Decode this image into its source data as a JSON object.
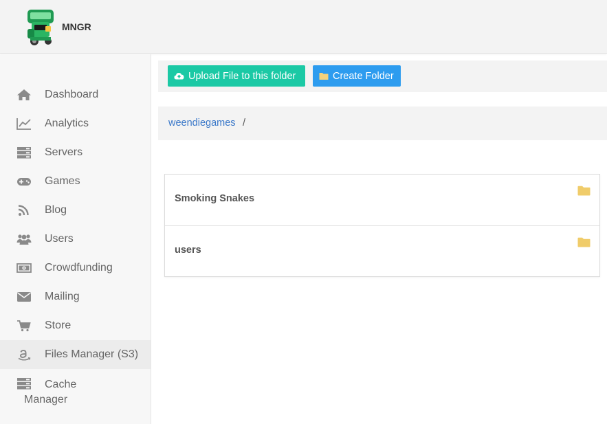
{
  "header": {
    "app_name": "MNGR",
    "logo_icon": "green-robot-logo"
  },
  "sidebar": {
    "items": [
      {
        "label": "Dashboard",
        "icon": "home-icon"
      },
      {
        "label": "Analytics",
        "icon": "line-chart-icon"
      },
      {
        "label": "Servers",
        "icon": "server-icon"
      },
      {
        "label": "Games",
        "icon": "gamepad-icon"
      },
      {
        "label": "Blog",
        "icon": "rss-icon"
      },
      {
        "label": "Users",
        "icon": "users-icon"
      },
      {
        "label": "Crowdfunding",
        "icon": "money-icon"
      },
      {
        "label": "Mailing",
        "icon": "envelope-icon"
      },
      {
        "label": "Store",
        "icon": "shopping-cart-icon"
      },
      {
        "label": "Files Manager (S3)",
        "icon": "amazon-icon",
        "active": true
      },
      {
        "label": "Cache Manager",
        "icon": "server-icon"
      }
    ]
  },
  "toolbar": {
    "upload_label": "Upload File to this folder",
    "create_folder_label": "Create Folder"
  },
  "breadcrumb": {
    "root": "weendiegames",
    "separator": "/"
  },
  "folders": [
    {
      "name": "Smoking Snakes"
    },
    {
      "name": "users"
    }
  ],
  "colors": {
    "upload_button": "#1bc9a5",
    "create_folder_button": "#2d9cef",
    "folder_icon": "#f0cc6a",
    "link": "#3a78c9"
  }
}
